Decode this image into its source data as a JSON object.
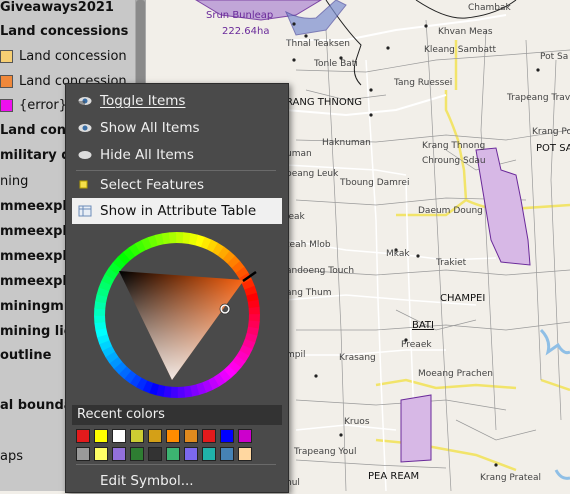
{
  "layers": [
    {
      "label": "Giveaways2021",
      "bold": true
    },
    {
      "label": "Land concessions",
      "bold": true
    },
    {
      "label": "Land concession",
      "swatch": "#f7cf73"
    },
    {
      "label": "Land concession",
      "swatch": "#f0883a"
    },
    {
      "label": "{error}",
      "swatch": "#ee10ee"
    },
    {
      "label": "Land conce",
      "bold": true
    },
    {
      "label": "military di",
      "bold": true
    },
    {
      "label": "ning",
      "bold": false
    },
    {
      "label": "mmeexplo",
      "bold": true
    },
    {
      "label": "mmeexplo",
      "bold": true
    },
    {
      "label": "mmeexplo",
      "bold": true
    },
    {
      "label": "mmeexplo",
      "bold": true
    },
    {
      "label": "miningmm",
      "bold": true
    },
    {
      "label": "mining lice",
      "bold": true
    },
    {
      "label": "outline",
      "bold": true
    },
    {
      "label": "al bounda",
      "bold": true
    },
    {
      "label": "aps",
      "bold": false
    }
  ],
  "menu": {
    "toggle_items": "Toggle Items",
    "show_all_items": "Show All Items",
    "hide_all_items": "Hide All Items",
    "select_features": "Select Features",
    "show_in_attribute_table": "Show in Attribute Table",
    "recent_colors": "Recent colors",
    "edit_symbol": "Edit Symbol..."
  },
  "recent_colors": [
    "#e31a1c",
    "#ffff00",
    "#ffffff",
    "#cccc33",
    "#d4a017",
    "#ff8c00",
    "#e08a1e",
    "#e31a1c",
    "#0000ff",
    "#cc00cc",
    "#9a9a9a",
    "#ffff66",
    "#9370db",
    "#2e7d32",
    "#333333",
    "#3cb371",
    "#7b68ee",
    "#20b2aa",
    "#4682b4",
    "#ffd7a0"
  ],
  "map_labels": {
    "srun_bunleap": "Srun Bunleap",
    "area": "222.64ha",
    "chambak": "Chambak",
    "khvan_meas": "Khvan Meas",
    "thnal_teaksen": "Thnal Teaksen",
    "pot_sa": "Pot Sa",
    "kleang_sambatt": "Kleang Sambatt",
    "tonle_bati": "Tonle Bati",
    "tang_ruessei": "Tang Ruessei",
    "trapeang_trav": "Trapeang Trav",
    "rang_thnong": "RANG THNONG",
    "krang_poun": "Krang Poun",
    "pot_sar": "POT SAR",
    "haknuman": "Haknuman",
    "uman": "uman",
    "krang_thnong": "Krang Thnong",
    "chroung_sdau": "Chroung Sdau",
    "peang_leuk": "peang Leuk",
    "tboung_damrei": "Tboung Damrei",
    "daeum_doung": "Daeum Doung",
    "leak": "leak",
    "teah_mlob": "teah Mlob",
    "mkak": "Mkak",
    "trakiet": "Trakiet",
    "andoeng_touch": "andoeng Touch",
    "chang_thum": "ang Thum",
    "champei": "CHAMPEI",
    "bati": "BATI",
    "preaek": "Preaek",
    "ampil": "mpil",
    "krasang": "Krasang",
    "moeang_prachen": "Moeang Prachen",
    "kruos": "Kruos",
    "trapeang_youl": "Trapeang Youl",
    "pea_ream": "PEA REAM",
    "krang_prateal": "Krang Prateal",
    "hul": "hul"
  }
}
